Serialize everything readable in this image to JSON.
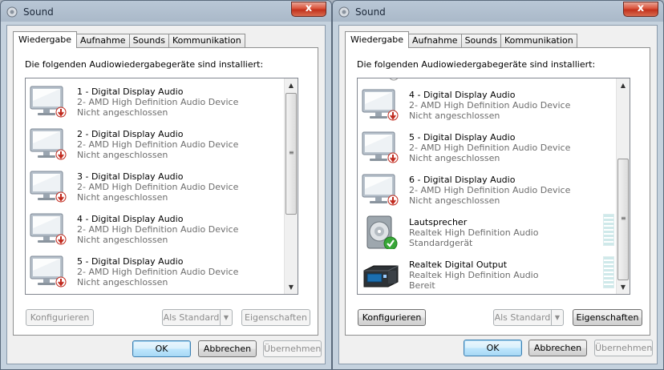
{
  "windows": [
    {
      "title": "Sound",
      "close_label": "x",
      "tabs": [
        "Wiedergabe",
        "Aufnahme",
        "Sounds",
        "Kommunikation"
      ],
      "description": "Die folgenden Audiowiedergabegeräte sind installiert:",
      "devices": [
        {
          "name": "1 - Digital Display Audio",
          "line2": "2- AMD High Definition Audio Device",
          "line3": "Nicht angeschlossen",
          "icon": "monitor-disconnected-icon"
        },
        {
          "name": "2 - Digital Display Audio",
          "line2": "2- AMD High Definition Audio Device",
          "line3": "Nicht angeschlossen",
          "icon": "monitor-disconnected-icon"
        },
        {
          "name": "3 - Digital Display Audio",
          "line2": "2- AMD High Definition Audio Device",
          "line3": "Nicht angeschlossen",
          "icon": "monitor-disconnected-icon"
        },
        {
          "name": "4 - Digital Display Audio",
          "line2": "2- AMD High Definition Audio Device",
          "line3": "Nicht angeschlossen",
          "icon": "monitor-disconnected-icon"
        },
        {
          "name": "5 - Digital Display Audio",
          "line2": "2- AMD High Definition Audio Device",
          "line3": "Nicht angeschlossen",
          "icon": "monitor-disconnected-icon"
        }
      ],
      "buttons": {
        "configure": "Konfigurieren",
        "set_default": "Als Standard",
        "properties": "Eigenschaften",
        "ok": "OK",
        "cancel": "Abbrechen",
        "apply": "Übernehmen"
      }
    },
    {
      "title": "Sound",
      "close_label": "x",
      "tabs": [
        "Wiedergabe",
        "Aufnahme",
        "Sounds",
        "Kommunikation"
      ],
      "description": "Die folgenden Audiowiedergabegeräte sind installiert:",
      "devices": [
        {
          "name": "4 - Digital Display Audio",
          "line2": "2- AMD High Definition Audio Device",
          "line3": "Nicht angeschlossen",
          "icon": "monitor-disconnected-icon"
        },
        {
          "name": "5 - Digital Display Audio",
          "line2": "2- AMD High Definition Audio Device",
          "line3": "Nicht angeschlossen",
          "icon": "monitor-disconnected-icon"
        },
        {
          "name": "6 - Digital Display Audio",
          "line2": "2- AMD High Definition Audio Device",
          "line3": "Nicht angeschlossen",
          "icon": "monitor-disconnected-icon"
        },
        {
          "name": "Lautsprecher",
          "line2": "Realtek High Definition Audio",
          "line3": "Standardgerät",
          "icon": "speaker-default-icon"
        },
        {
          "name": "Realtek Digital Output",
          "line2": "Realtek High Definition Audio",
          "line3": "Bereit",
          "icon": "digital-output-icon"
        }
      ],
      "buttons": {
        "configure": "Konfigurieren",
        "set_default": "Als Standard",
        "properties": "Eigenschaften",
        "ok": "OK",
        "cancel": "Abbrechen",
        "apply": "Übernehmen"
      }
    }
  ],
  "colors": {
    "accent": "#3c7fb1",
    "disconnected": "#c0281c",
    "default_check": "#2e9b2e",
    "secondary_text": "#6d6d6d"
  }
}
